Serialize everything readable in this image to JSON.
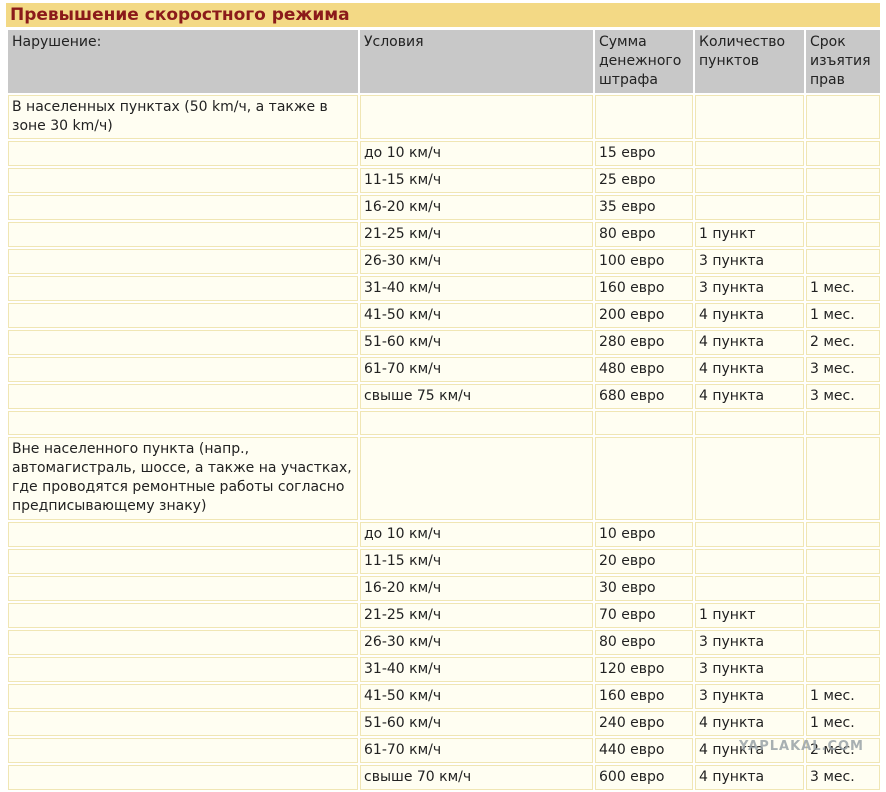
{
  "title": "Превышение скоростного режима",
  "headers": {
    "violation": "Нарушение:",
    "conditions": "Условия",
    "fine": "Сумма денежного штрафа",
    "points": "Количество пунктов",
    "suspension": "Срок изъятия прав"
  },
  "sections": [
    {
      "label": "В населенных пунктах (50 km/ч, а также в зоне 30 km/ч)",
      "rows": [
        {
          "condition": "до 10 км/ч",
          "fine": "15 евро",
          "points": "",
          "suspension": ""
        },
        {
          "condition": "11-15 км/ч",
          "fine": "25 евро",
          "points": "",
          "suspension": ""
        },
        {
          "condition": "16-20 км/ч",
          "fine": "35 евро",
          "points": "",
          "suspension": ""
        },
        {
          "condition": "21-25 км/ч",
          "fine": "80 евро",
          "points": "1 пункт",
          "suspension": ""
        },
        {
          "condition": "26-30 км/ч",
          "fine": "100 евро",
          "points": "3 пункта",
          "suspension": ""
        },
        {
          "condition": "31-40 км/ч",
          "fine": "160 евро",
          "points": "3 пункта",
          "suspension": "1 мес."
        },
        {
          "condition": "41-50 км/ч",
          "fine": "200 евро",
          "points": "4 пункта",
          "suspension": "1 мес."
        },
        {
          "condition": "51-60 км/ч",
          "fine": "280 евро",
          "points": "4 пункта",
          "suspension": "2 мес."
        },
        {
          "condition": "61-70 км/ч",
          "fine": "480 евро",
          "points": "4 пункта",
          "suspension": "3 мес."
        },
        {
          "condition": "свыше 75 км/ч",
          "fine": "680 евро",
          "points": "4 пункта",
          "suspension": "3 мес."
        }
      ]
    },
    {
      "label": "Вне населенного пункта (напр., автомагистраль, шоссе, а также на участках, где проводятся ремонтные работы согласно предписывающему знаку)",
      "rows": [
        {
          "condition": "до 10 км/ч",
          "fine": "10 евро",
          "points": "",
          "suspension": ""
        },
        {
          "condition": "11-15 км/ч",
          "fine": "20 евро",
          "points": "",
          "suspension": ""
        },
        {
          "condition": "16-20 км/ч",
          "fine": "30 евро",
          "points": "",
          "suspension": ""
        },
        {
          "condition": "21-25 км/ч",
          "fine": "70 евро",
          "points": "1 пункт",
          "suspension": ""
        },
        {
          "condition": "26-30 км/ч",
          "fine": "80 евро",
          "points": "3 пункта",
          "suspension": ""
        },
        {
          "condition": "31-40 км/ч",
          "fine": "120 евро",
          "points": "3 пункта",
          "suspension": ""
        },
        {
          "condition": "41-50 км/ч",
          "fine": "160 евро",
          "points": "3 пункта",
          "suspension": "1 мес."
        },
        {
          "condition": "51-60 км/ч",
          "fine": "240 евро",
          "points": "4 пункта",
          "suspension": "1 мес."
        },
        {
          "condition": "61-70 км/ч",
          "fine": "440 евро",
          "points": "4 пункта",
          "suspension": "2 мес."
        },
        {
          "condition": "свыше 70 км/ч",
          "fine": "600 евро",
          "points": "4 пункта",
          "suspension": "3 мес."
        }
      ]
    }
  ],
  "watermark": "YAPLAKAL.COM"
}
